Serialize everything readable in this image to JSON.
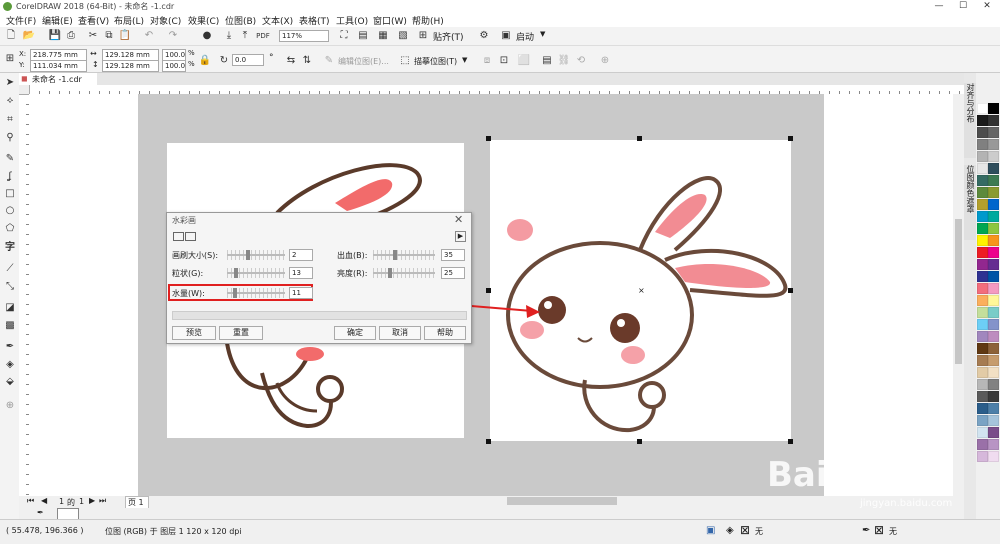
{
  "window": {
    "title": "CorelDRAW 2018 (64-Bit) - 未命名 -1.cdr",
    "minimize": "—",
    "maximize": "☐",
    "close": "✕"
  },
  "menu": [
    "文件(F)",
    "编辑(E)",
    "查看(V)",
    "布局(L)",
    "对象(C)",
    "效果(C)",
    "位图(B)",
    "文本(X)",
    "表格(T)",
    "工具(O)",
    "窗口(W)",
    "帮助(H)"
  ],
  "toolbar1": {
    "zoom": "117%",
    "snap_label": "贴齐(T)",
    "launch_label": "启动"
  },
  "toolbar2": {
    "x": "218.775 mm",
    "y": "111.034 mm",
    "w": "129.128 mm",
    "h": "129.128 mm",
    "sx": "100.0",
    "sy": "100.0",
    "pct": "%",
    "rotation": "0.0",
    "edit_bitmap": "编辑位图(E)...",
    "trace_bitmap": "描摹位图(T)",
    "x_label": "X:",
    "y_label": "Y:"
  },
  "doc_tab": "未命名 -1.cdr",
  "dialog": {
    "title": "水彩画",
    "params": [
      {
        "label": "画刷大小(S):",
        "value": "2",
        "pos": 0.35
      },
      {
        "label": "出血(B):",
        "value": "35",
        "pos": 0.35
      },
      {
        "label": "粒状(G):",
        "value": "13",
        "pos": 0.13
      },
      {
        "label": "亮度(R):",
        "value": "25",
        "pos": 0.25
      },
      {
        "label": "水量(W):",
        "value": "11",
        "pos": 0.11
      }
    ],
    "preview": "预览",
    "reset": "重置",
    "ok": "确定",
    "cancel": "取消",
    "help": "帮助"
  },
  "pager": {
    "current": "1",
    "of": "的",
    "total": "1",
    "page_tab": "页 1"
  },
  "status": {
    "coords": "( 55.478, 196.366 )",
    "info": "位图 (RGB) 于 图层 1 120 x 120 dpi",
    "fill": "无",
    "outline": "无"
  },
  "dock_tabs": [
    "对齐与分布",
    "位图颜色遮罩"
  ],
  "watermark": {
    "brand": "Bai",
    "brand2": "百",
    "brand3": "经验",
    "url": "jingyan.baidu.com"
  },
  "palette_colors": [
    "#ffffff",
    "#000000",
    "#1a1a1a",
    "#333333",
    "#4d4d4d",
    "#666666",
    "#808080",
    "#999999",
    "#b3b3b3",
    "#cccccc",
    "#e6e6e6",
    "#2e4d5c",
    "#356b63",
    "#3d7a52",
    "#5d8a3c",
    "#8a9a30",
    "#b3a02c",
    "#0066cc",
    "#0099cc",
    "#00a99d",
    "#00a651",
    "#8dc63f",
    "#fff200",
    "#f7941d",
    "#ed1c24",
    "#ec008c",
    "#92278f",
    "#662d91",
    "#2e3192",
    "#0054a6",
    "#f26d7d",
    "#f49ac1",
    "#fbaf5d",
    "#fff799",
    "#c4df9b",
    "#7accc8",
    "#6dcff6",
    "#8493ca",
    "#a187be",
    "#bd8cbf",
    "#603913",
    "#8c6239",
    "#a67c52",
    "#c69c6d",
    "#e2cba6",
    "#f2e0c4",
    "#b7b7b7",
    "#828282",
    "#5a5a5a",
    "#3a3a3a",
    "#2a5d8a",
    "#4d7fa8",
    "#7aa3c4",
    "#a6c4db",
    "#d2e4f0",
    "#7a4d8a",
    "#9a70a8",
    "#b894c4",
    "#d6b8db",
    "#f0dcf0"
  ]
}
